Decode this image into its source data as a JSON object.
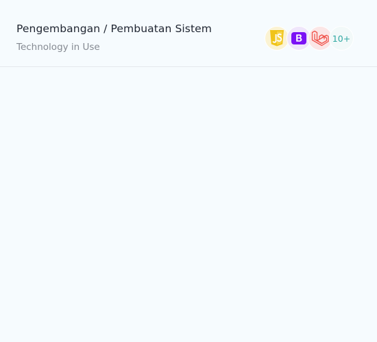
{
  "header": {
    "title": "Pengembangan / Pembuatan Sistem",
    "subtitle": "Technology in Use"
  },
  "tech_stack": {
    "items": [
      {
        "icon": "javascript-icon",
        "color": "#f0c419"
      },
      {
        "icon": "bootstrap-icon",
        "color": "#7b12f5"
      },
      {
        "icon": "laravel-icon",
        "color": "#f0534b"
      }
    ],
    "more_label": "10+",
    "more_color": "#2fa8a2"
  }
}
